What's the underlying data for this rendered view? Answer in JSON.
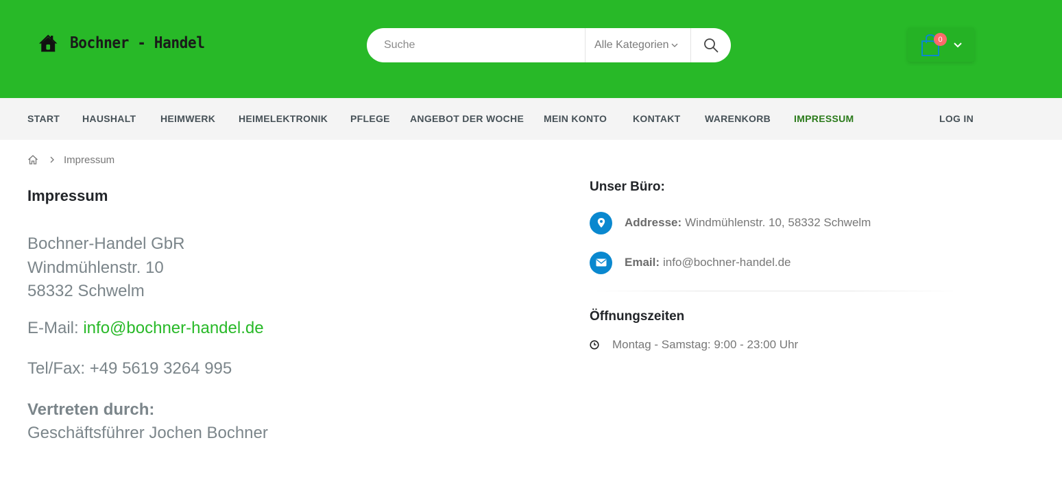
{
  "header": {
    "logo_text": "Bochner - Handel",
    "search": {
      "placeholder": "Suche",
      "category": "Alle Kategorien"
    },
    "cart": {
      "count": "0"
    }
  },
  "nav": {
    "items": [
      {
        "label": "START"
      },
      {
        "label": "HAUSHALT"
      },
      {
        "label": "HEIMWERK"
      },
      {
        "label": "HEIMELEKTRONIK"
      },
      {
        "label": "PFLEGE"
      },
      {
        "label": "ANGEBOT DER WOCHE"
      },
      {
        "label": "MEIN KONTO"
      },
      {
        "label": "KONTAKT"
      },
      {
        "label": "WARENKORB"
      },
      {
        "label": "IMPRESSUM",
        "active": true
      }
    ],
    "login": "LOG IN"
  },
  "breadcrumb": {
    "current": "Impressum"
  },
  "impressum": {
    "title": "Impressum",
    "company": "Bochner-Handel GbR",
    "street": "Windmühlenstr. 10",
    "city": "58332 Schwelm",
    "email_label": "E-Mail: ",
    "email": "info@bochner-handel.de",
    "tel": "Tel/Fax: +49 5619 3264 995",
    "represented_label": "Vertreten durch:",
    "represented": "Geschäftsführer Jochen Bochner"
  },
  "office": {
    "title": "Unser Büro:",
    "address_label": "Addresse:",
    "address": "Windmühlenstr. 10, 58332 Schwelm",
    "email_label": "Email:",
    "email": "info@bochner-handel.de",
    "hours_title": "Öffnungszeiten",
    "hours": "Montag - Samstag: 9:00 - 23:00 Uhr"
  },
  "colors": {
    "header_bg": "#28b928",
    "nav_bg": "#f4f4f4",
    "accent_blue": "#0a88cf",
    "active_nav": "#2a7a1a",
    "link_green": "#28b928",
    "badge": "#ff6a6a"
  },
  "icons": [
    "house-logo-icon",
    "search-icon",
    "chevron-down-icon",
    "shopping-bag-icon",
    "home-icon",
    "chevron-right-icon",
    "map-marker-icon",
    "envelope-icon",
    "clock-icon"
  ]
}
